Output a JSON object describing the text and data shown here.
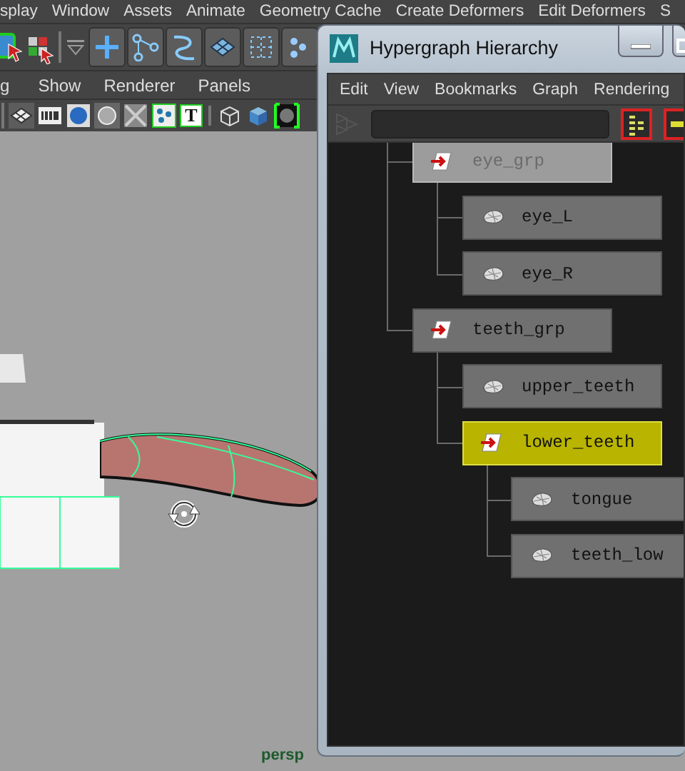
{
  "app_menu": [
    "splay",
    "Window",
    "Assets",
    "Animate",
    "Geometry Cache",
    "Create Deformers",
    "Edit Deformers",
    "S"
  ],
  "panel_menu": [
    "g",
    "Show",
    "Renderer",
    "Panels"
  ],
  "panel_toolbar": {
    "text_icon": "T"
  },
  "viewport": {
    "camera_label": "persp"
  },
  "hypergraph": {
    "title": "Hypergraph Hierarchy",
    "menu": [
      "Edit",
      "View",
      "Bookmarks",
      "Graph",
      "Rendering"
    ],
    "nodes": [
      {
        "label": "eye_grp",
        "kind": "group",
        "selected": false,
        "dimmed": true,
        "children": [
          {
            "label": "eye_L",
            "kind": "mesh",
            "selected": false,
            "dimmed": false
          },
          {
            "label": "eye_R",
            "kind": "mesh",
            "selected": false,
            "dimmed": false
          }
        ]
      },
      {
        "label": "teeth_grp",
        "kind": "group",
        "selected": false,
        "dimmed": false,
        "children": [
          {
            "label": "upper_teeth",
            "kind": "mesh",
            "selected": false,
            "dimmed": false
          },
          {
            "label": "lower_teeth",
            "kind": "group",
            "selected": true,
            "dimmed": false,
            "children": [
              {
                "label": "tongue",
                "kind": "mesh",
                "selected": false,
                "dimmed": false
              },
              {
                "label": "teeth_low",
                "kind": "mesh",
                "selected": false,
                "dimmed": false
              }
            ]
          }
        ]
      }
    ]
  }
}
